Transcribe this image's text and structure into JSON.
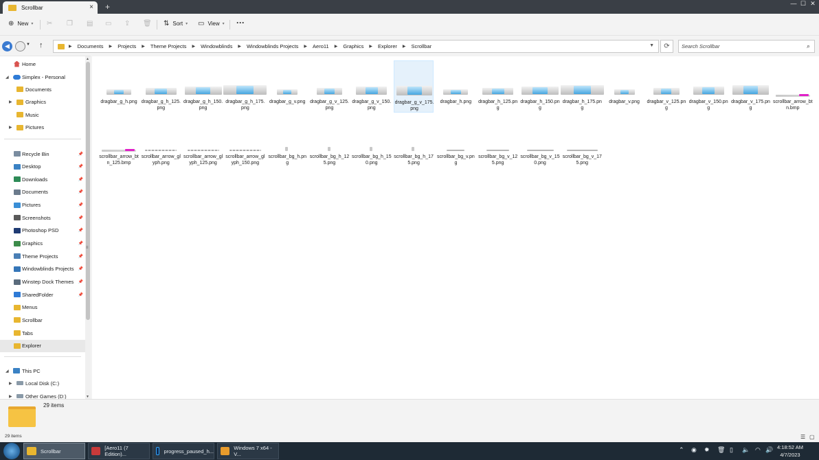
{
  "window": {
    "tab_title": "Scrollbar",
    "tab_close": "×",
    "new_tab": "+",
    "controls": [
      "—",
      "☐",
      "✕"
    ]
  },
  "commandbar": {
    "new_label": "New",
    "sort_label": "Sort",
    "view_label": "View",
    "more_label": "···"
  },
  "breadcrumb": [
    "Documents",
    "Projects",
    "Theme Projects",
    "Windowblinds",
    "Windowblinds Projects",
    "Aero11",
    "Graphics",
    "Explorer",
    "Scrollbar"
  ],
  "search": {
    "placeholder": "Search Scrollbar"
  },
  "nav": {
    "home": "Home",
    "cloud": "Simplex - Personal",
    "cloud_children": [
      "Documents",
      "Graphics",
      "Music",
      "Pictures"
    ],
    "quick_access": [
      {
        "label": "Recycle Bin",
        "icon": "recycle-bin-icon",
        "color": "#7a8da0"
      },
      {
        "label": "Desktop",
        "icon": "desktop-icon",
        "color": "#3b82c4"
      },
      {
        "label": "Downloads",
        "icon": "downloads-icon",
        "color": "#2e8b57"
      },
      {
        "label": "Documents",
        "icon": "documents-icon",
        "color": "#6b7b8c"
      },
      {
        "label": "Pictures",
        "icon": "pictures-icon",
        "color": "#3a8fd6"
      },
      {
        "label": "Screenshots",
        "icon": "screenshots-icon",
        "color": "#5a5a5a"
      },
      {
        "label": "Photoshop PSD",
        "icon": "photoshop-icon",
        "color": "#1f3b73"
      },
      {
        "label": "Graphics",
        "icon": "graphics-icon",
        "color": "#3c8c4a"
      },
      {
        "label": "Theme Projects",
        "icon": "theme-projects-icon",
        "color": "#4a7fb5"
      },
      {
        "label": "Windowblinds Projects",
        "icon": "windowblinds-icon",
        "color": "#3576b8"
      },
      {
        "label": "Winstep Dock Themes",
        "icon": "winstep-icon",
        "color": "#5a6b7c"
      },
      {
        "label": "SharedFolder",
        "icon": "shared-folder-icon",
        "color": "#2f7bd6"
      },
      {
        "label": "Menus",
        "icon": "folder-icon",
        "color": "#e8b630"
      },
      {
        "label": "Scrollbar",
        "icon": "folder-icon",
        "color": "#e8b630"
      },
      {
        "label": "Tabs",
        "icon": "folder-icon",
        "color": "#e8b630"
      },
      {
        "label": "Explorer",
        "icon": "folder-icon",
        "color": "#e8b630"
      }
    ],
    "this_pc": "This PC",
    "drives": [
      "Local Disk (C:)",
      "Other Games (D:)"
    ]
  },
  "files": [
    "dragbar_g_h.png",
    "dragbar_g_h_125.png",
    "dragbar_g_h_150.png",
    "dragbar_g_h_175.png",
    "dragbar_g_v.png",
    "dragbar_g_v_125.png",
    "dragbar_g_v_150.png",
    "dragbar_g_v_175.png",
    "dragbar_h.png",
    "dragbar_h_125.png",
    "dragbar_h_150.png",
    "dragbar_h_175.png",
    "dragbar_v.png",
    "dragbar_v_125.png",
    "dragbar_v_150.png",
    "dragbar_v_175.png",
    "scrollbar_arrow_btn.bmp",
    "scrollbar_arrow_btn_125.bmp",
    "scrollbar_arrow_glyph.png",
    "scrollbar_arrow_glyph_125.png",
    "scrollbar_arrow_glyph_150.png",
    "scrollbar_bg_h.png",
    "scrollbar_bg_h_125.png",
    "scrollbar_bg_h_150.png",
    "scrollbar_bg_h_175.png",
    "scrollbar_bg_v.png",
    "scrollbar_bg_v_125.png",
    "scrollbar_bg_v_150.png",
    "scrollbar_bg_v_175.png"
  ],
  "selected_file": "dragbar_g_v_175.png",
  "status": {
    "item_count": "29 items",
    "item_count_small": "29 items"
  },
  "taskbar": {
    "tasks": [
      "Scrollbar",
      "[Aero11 (7 Edition)...",
      "progress_paused_h...",
      "Windows 7 x64 - V..."
    ],
    "time": "4:18:52 AM",
    "date": "4/7/2023"
  },
  "colors": {
    "accent": "#3b7bd1",
    "selection": "#e5f1fb",
    "folder": "#e8b630",
    "magenta": "#e020c8",
    "bar_blue": "#4fb0e8"
  }
}
